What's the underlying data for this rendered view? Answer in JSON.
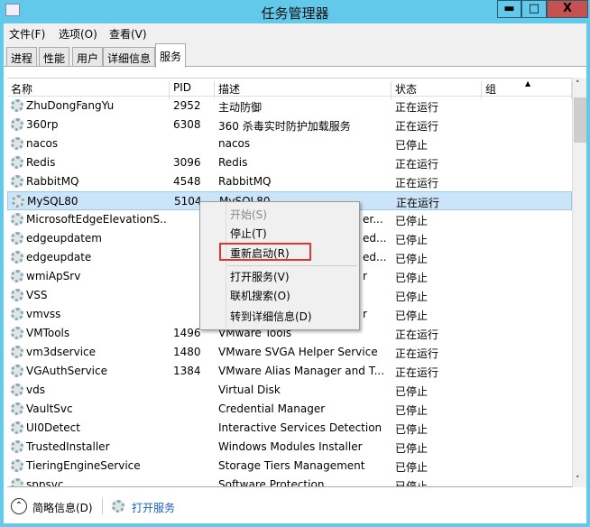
{
  "window": {
    "title": "任务管理器",
    "minimize": "▬",
    "maximize": "□",
    "close": "X"
  },
  "menu": [
    "文件(F)",
    "选项(O)",
    "查看(V)"
  ],
  "tabs": [
    {
      "label": "进程"
    },
    {
      "label": "性能"
    },
    {
      "label": "用户"
    },
    {
      "label": "详细信息"
    },
    {
      "label": "服务",
      "active": true
    }
  ],
  "columns": {
    "name": "名称",
    "pid": "PID",
    "desc": "描述",
    "status": "状态",
    "group": "组"
  },
  "rows": [
    {
      "name": "ZhuDongFangYu",
      "pid": "2952",
      "desc": "主动防御",
      "status": "正在运行"
    },
    {
      "name": "360rp",
      "pid": "6308",
      "desc": "360 杀毒实时防护加载服务",
      "status": "正在运行"
    },
    {
      "name": "nacos",
      "pid": "",
      "desc": "nacos",
      "status": "已停止"
    },
    {
      "name": "Redis",
      "pid": "3096",
      "desc": "Redis",
      "status": "正在运行"
    },
    {
      "name": "RabbitMQ",
      "pid": "4548",
      "desc": "RabbitMQ",
      "status": "正在运行"
    },
    {
      "name": "MySQL80",
      "pid": "5104",
      "desc": "MySQL80",
      "status": "正在运行",
      "selected": true
    },
    {
      "name": "MicrosoftEdgeElevationS...",
      "pid": "",
      "desc": "er...",
      "status": "已停止",
      "hidden_desc": true
    },
    {
      "name": "edgeupdatem",
      "pid": "",
      "desc": "ed...",
      "status": "已停止",
      "hidden_desc": true
    },
    {
      "name": "edgeupdate",
      "pid": "",
      "desc": "ed...",
      "status": "已停止",
      "hidden_desc": true
    },
    {
      "name": "wmiApSrv",
      "pid": "",
      "desc": "r",
      "status": "已停止",
      "hidden_desc": true
    },
    {
      "name": "VSS",
      "pid": "",
      "desc": "",
      "status": "已停止",
      "hidden_desc": true
    },
    {
      "name": "vmvss",
      "pid": "",
      "desc": "r",
      "status": "已停止",
      "hidden_desc": true
    },
    {
      "name": "VMTools",
      "pid": "1496",
      "desc": "VMware Tools",
      "status": "正在运行"
    },
    {
      "name": "vm3dservice",
      "pid": "1480",
      "desc": "VMware SVGA Helper Service",
      "status": "正在运行"
    },
    {
      "name": "VGAuthService",
      "pid": "1384",
      "desc": "VMware Alias Manager and T...",
      "status": "正在运行"
    },
    {
      "name": "vds",
      "pid": "",
      "desc": "Virtual Disk",
      "status": "已停止"
    },
    {
      "name": "VaultSvc",
      "pid": "",
      "desc": "Credential Manager",
      "status": "已停止"
    },
    {
      "name": "UI0Detect",
      "pid": "",
      "desc": "Interactive Services Detection",
      "status": "已停止"
    },
    {
      "name": "TrustedInstaller",
      "pid": "",
      "desc": "Windows Modules Installer",
      "status": "已停止"
    },
    {
      "name": "TieringEngineService",
      "pid": "",
      "desc": "Storage Tiers Management",
      "status": "已停止"
    },
    {
      "name": "sppsvc",
      "pid": "",
      "desc": "Software Protection",
      "status": "已停止"
    }
  ],
  "context_menu": {
    "items": [
      {
        "label": "开始(S)",
        "disabled": true
      },
      {
        "label": "停止(T)"
      },
      {
        "label": "重新启动(R)",
        "highlighted_box": true
      },
      {
        "label": "打开服务(V)"
      },
      {
        "label": "联机搜索(O)"
      },
      {
        "label": "转到详细信息(D)"
      }
    ]
  },
  "footer": {
    "collapse": "简略信息(D)",
    "open_services": "打开服务"
  },
  "colors": {
    "titlebar": "#62c9ea",
    "close": "#c75050",
    "selection": "#cce4f7",
    "highlight_box": "#e53333",
    "link": "#1a5fb4"
  }
}
